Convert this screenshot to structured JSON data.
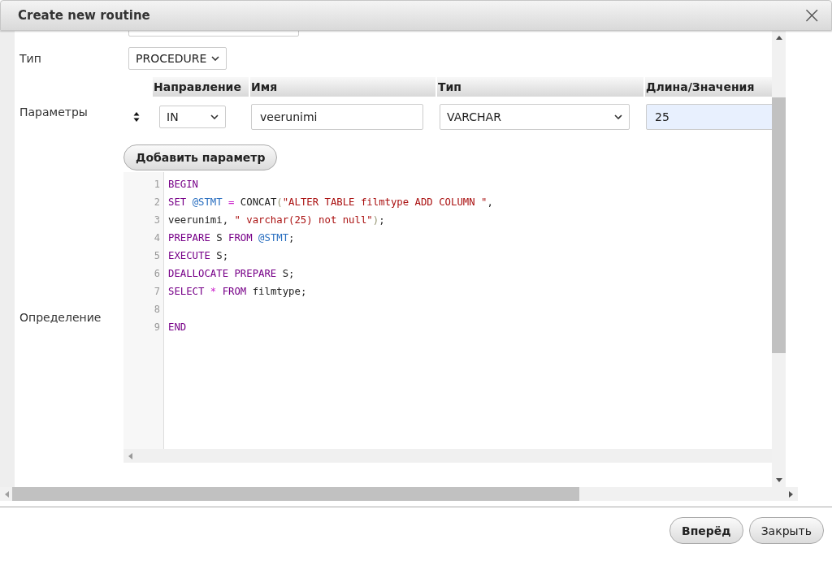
{
  "window": {
    "title": "Create new routine",
    "close": "×"
  },
  "form": {
    "type_label": "Тип",
    "type_value": "PROCEDURE",
    "params_label": "Параметры",
    "param_columns": [
      "Направление",
      "Имя",
      "Тип",
      "Длина/Значения"
    ],
    "params": [
      {
        "direction": "IN",
        "name": "veerunimi",
        "type": "VARCHAR",
        "length": "25"
      }
    ],
    "add_param": "Добавить параметр",
    "definition_label": "Определение",
    "code": [
      {
        "number": "1",
        "tokens": [
          {
            "kind": "keyword",
            "text": "BEGIN"
          }
        ]
      },
      {
        "number": "2",
        "tokens": [
          {
            "kind": "keyword",
            "text": "SET "
          },
          {
            "kind": "variable",
            "text": "@STMT "
          },
          {
            "kind": "operator",
            "text": "= "
          },
          {
            "kind": "plain",
            "text": "CONCAT"
          },
          {
            "kind": "bracket",
            "text": "("
          },
          {
            "kind": "string",
            "text": "\"ALTER TABLE filmtype ADD COLUMN \""
          },
          {
            "kind": "plain",
            "text": ","
          }
        ]
      },
      {
        "number": "3",
        "tokens": [
          {
            "kind": "plain",
            "text": "veerunimi, "
          },
          {
            "kind": "string",
            "text": "\" varchar(25) not null\""
          },
          {
            "kind": "bracket",
            "text": ")"
          },
          {
            "kind": "plain",
            "text": ";"
          }
        ]
      },
      {
        "number": "4",
        "tokens": [
          {
            "kind": "keyword",
            "text": "PREPARE"
          },
          {
            "kind": "plain",
            "text": " S "
          },
          {
            "kind": "keyword",
            "text": "FROM "
          },
          {
            "kind": "variable",
            "text": "@STMT"
          },
          {
            "kind": "plain",
            "text": ";"
          }
        ]
      },
      {
        "number": "5",
        "tokens": [
          {
            "kind": "keyword",
            "text": "EXECUTE"
          },
          {
            "kind": "plain",
            "text": " S;"
          }
        ]
      },
      {
        "number": "6",
        "tokens": [
          {
            "kind": "keyword",
            "text": "DEALLOCATE PREPARE"
          },
          {
            "kind": "plain",
            "text": " S;"
          }
        ]
      },
      {
        "number": "7",
        "tokens": [
          {
            "kind": "keyword",
            "text": "SELECT "
          },
          {
            "kind": "operator",
            "text": "* "
          },
          {
            "kind": "keyword",
            "text": "FROM"
          },
          {
            "kind": "plain",
            "text": " filmtype;"
          }
        ]
      },
      {
        "number": "8"
      },
      {
        "number": "9",
        "tokens": [
          {
            "kind": "keyword",
            "text": "END"
          }
        ]
      }
    ]
  },
  "buttons": [
    {
      "label": "Вперёд",
      "primary": true
    },
    {
      "label": "Закрыть",
      "primary": false
    }
  ]
}
